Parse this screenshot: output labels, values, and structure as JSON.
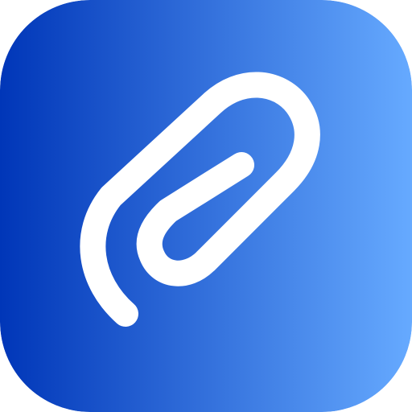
{
  "icon": {
    "name": "paperclip-icon",
    "colors": {
      "gradient_start": "#0036B8",
      "gradient_end": "#66AAFF",
      "glyph": "#FFFFFF"
    }
  }
}
